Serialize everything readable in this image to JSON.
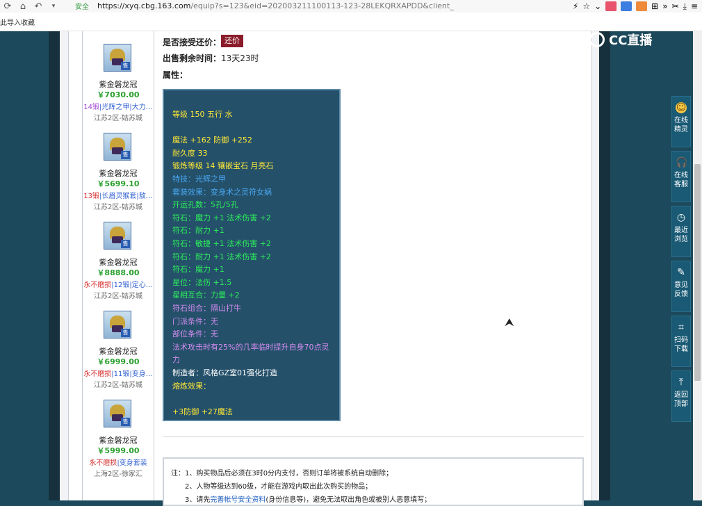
{
  "browser": {
    "secure_label": "安全",
    "host": "https://xyq.cbg.163.com",
    "path": "/equip?s=123&eid=202003211100113-123-28LEKQRXAPDD&client_",
    "bookmark_hint": "此导入收藏"
  },
  "cc_logo": "CC直播",
  "listings": [
    {
      "name": "紫金磐龙冠",
      "price": "￥7030.00",
      "attrs": "14锻|光辉之甲|大力…",
      "server": "江苏2区-姑苏城",
      "thumb_tag": "售"
    },
    {
      "name": "紫金磐龙冠",
      "price": "￥5699.10",
      "attrs": "13锻|长眉灵猴套|敖…",
      "server": "江苏2区-姑苏城",
      "thumb_tag": "售"
    },
    {
      "name": "紫金磐龙冠",
      "price": "￥8888.00",
      "attrs": "永不磨损|12锻|定心…",
      "server": "江苏2区-姑苏城",
      "thumb_tag": "售"
    },
    {
      "name": "紫金磐龙冠",
      "price": "￥6999.00",
      "attrs": "永不磨损|11锻|变身…",
      "server": "江苏2区-姑苏城",
      "thumb_tag": "售"
    },
    {
      "name": "紫金磐龙冠",
      "price": "￥5999.00",
      "attrs": "永不磨损|变身套装",
      "server": "上海2区-徐家汇",
      "thumb_tag": "售"
    }
  ],
  "detail": {
    "counter_label": "是否接受还价：",
    "counter_button": "还价",
    "remaining_label": "出售剩余时间：",
    "remaining_value": "13天23时",
    "attr_label": "属性："
  },
  "attributes": [
    "等级 150 五行 水",
    "",
    "魔法 +162 防御 +252",
    "耐久度 33",
    "锻炼等级 14 镶嵌宝石 月亮石",
    "特技：光辉之甲",
    "套装效果：变身术之灵符女娲",
    "开运孔数：5孔/5孔",
    "符石：魔力 +1 法术伤害 +2",
    "符石：耐力 +1",
    "符石：敏捷 +1 法术伤害 +2",
    "符石：耐力 +1 法术伤害 +2",
    "符石：魔力 +1",
    "星位：法伤 +1.5",
    "星相互合：力量 +2",
    "符石组合：隔山打牛",
    "门派条件：无",
    "部位条件：无",
    "法术攻击时有25%的几率临时提升自身70点灵",
    "力",
    "制造者：风格GZ室01强化打造",
    "熔炼效果：",
    "",
    "+3防御 +27魔法"
  ],
  "attr_colors": [
    "y",
    "y",
    "y",
    "y",
    "y",
    "b",
    "b",
    "g",
    "g",
    "g",
    "g",
    "g",
    "g",
    "g",
    "g",
    "p",
    "p",
    "p",
    "p",
    "p",
    "w",
    "y",
    "y",
    "y"
  ],
  "notes": {
    "line1": "注：1、购买物品后必须在3时0分内支付，否则订单将被系统自动删除；",
    "line2": "2、人物等级达到60级，才能在游戏内取出此次购买的物品；",
    "line3_pre": "3、请先",
    "line3_link": "完善帐号安全资料",
    "line3_post": "(身份信息等)，避免无法取出角色或被别人恶意填写；"
  },
  "sidetools": [
    {
      "label": "在线精灵",
      "icon": "avatar-icon"
    },
    {
      "label": "在线客服",
      "icon": "headset-icon"
    },
    {
      "label": "最近浏览",
      "icon": "clock-icon"
    },
    {
      "label": "意见反馈",
      "icon": "edit-icon"
    },
    {
      "label": "扫码下载",
      "icon": "scan-icon"
    },
    {
      "label": "返回顶部",
      "icon": "arrow-up-icon"
    }
  ]
}
